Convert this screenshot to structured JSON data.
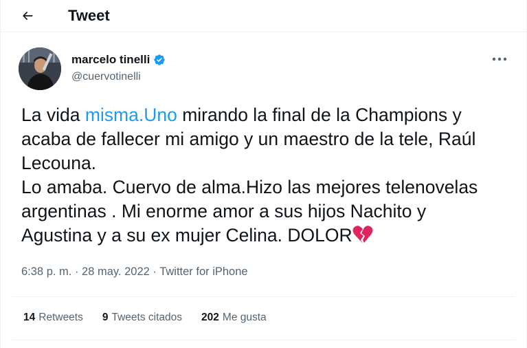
{
  "header": {
    "title": "Tweet"
  },
  "author": {
    "name": "marcelo tinelli",
    "handle": "@cuervotinelli"
  },
  "tweet": {
    "text_before": "La vida ",
    "mention": "misma.Uno",
    "text_after": " mirando la final de la Champions y\nacaba de fallecer mi amigo y un maestro de la tele, Raúl\nLecouna.\nLo amaba. Cuervo de alma.Hizo las mejores telenovelas\nargentinas . Mi enorme amor a sus hijos Nachito y\nAgustina y a su ex mujer Celina. DOLOR",
    "emoji": "broken-heart-icon"
  },
  "meta": {
    "time": "6:38 p. m.",
    "separator1": " · ",
    "date": "28 may. 2022",
    "separator2": " · ",
    "source": "Twitter for iPhone"
  },
  "stats": [
    {
      "count": "14",
      "label": "Retweets"
    },
    {
      "count": "9",
      "label": "Tweets citados"
    },
    {
      "count": "202",
      "label": "Me gusta"
    }
  ],
  "colors": {
    "link": "#1d9bf0",
    "secondary_text": "#536471",
    "primary_text": "#0f1419",
    "verified": "#1d9bf0",
    "heart": "#e0245e"
  }
}
